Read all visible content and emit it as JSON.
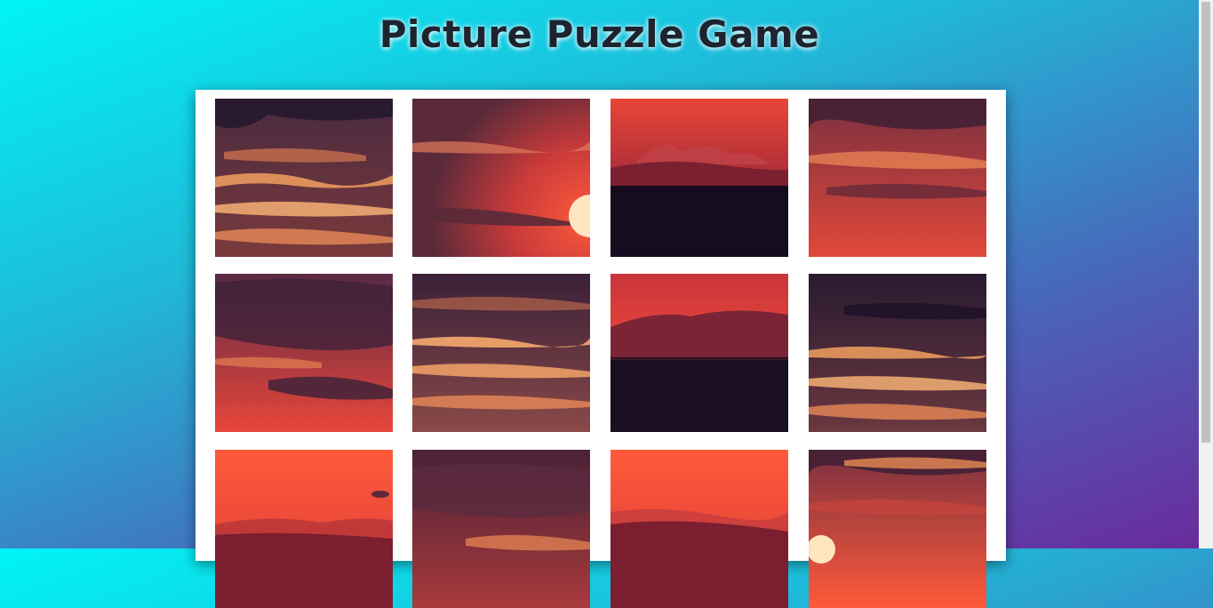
{
  "page": {
    "title": "Picture Puzzle Game"
  },
  "colors": {
    "gradient_start": "#00f4f6",
    "gradient_end": "#6b2a9c",
    "sky_red": "#e8463a",
    "dark_cloud": "#3a2038",
    "glow_orange": "#ff9a5a",
    "sea_dark": "#150c20"
  },
  "tiles": [
    {
      "scene": "cloud-bands-golden"
    },
    {
      "scene": "sun-right-red"
    },
    {
      "scene": "mountains-dark-sea"
    },
    {
      "scene": "clouds-red"
    },
    {
      "scene": "dark-clouds-red-bottom"
    },
    {
      "scene": "cloud-bands-golden-2"
    },
    {
      "scene": "mountain-sea"
    },
    {
      "scene": "cloud-bands-dark"
    },
    {
      "scene": "bright-red-hills"
    },
    {
      "scene": "dark-clouds-horizon"
    },
    {
      "scene": "bright-red-hills-2"
    },
    {
      "scene": "sun-bottom-clouds"
    }
  ]
}
